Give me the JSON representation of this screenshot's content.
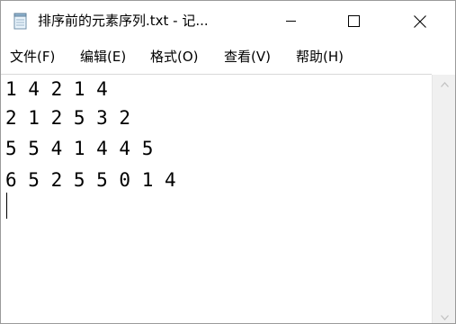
{
  "window": {
    "title": "排序前的元素序列.txt - 记..."
  },
  "menu": {
    "file": "文件(F)",
    "edit": "编辑(E)",
    "format": "格式(O)",
    "view": "查看(V)",
    "help": "帮助(H)"
  },
  "document": {
    "lines": [
      "1 4 2 1 4",
      "2 1 2 5 3 2",
      "5 5 4 1 4 4 5",
      "6 5 2 5 5 0 1 4"
    ]
  },
  "icons": {
    "app": "notepad-icon",
    "minimize": "minimize-icon",
    "maximize": "maximize-icon",
    "close": "close-icon",
    "scroll_up": "chevron-up-icon",
    "scroll_down": "chevron-down-icon"
  },
  "colors": {
    "text": "#000000",
    "scrollbar": "#f0f0f0",
    "arrow": "#c2c2c2"
  }
}
